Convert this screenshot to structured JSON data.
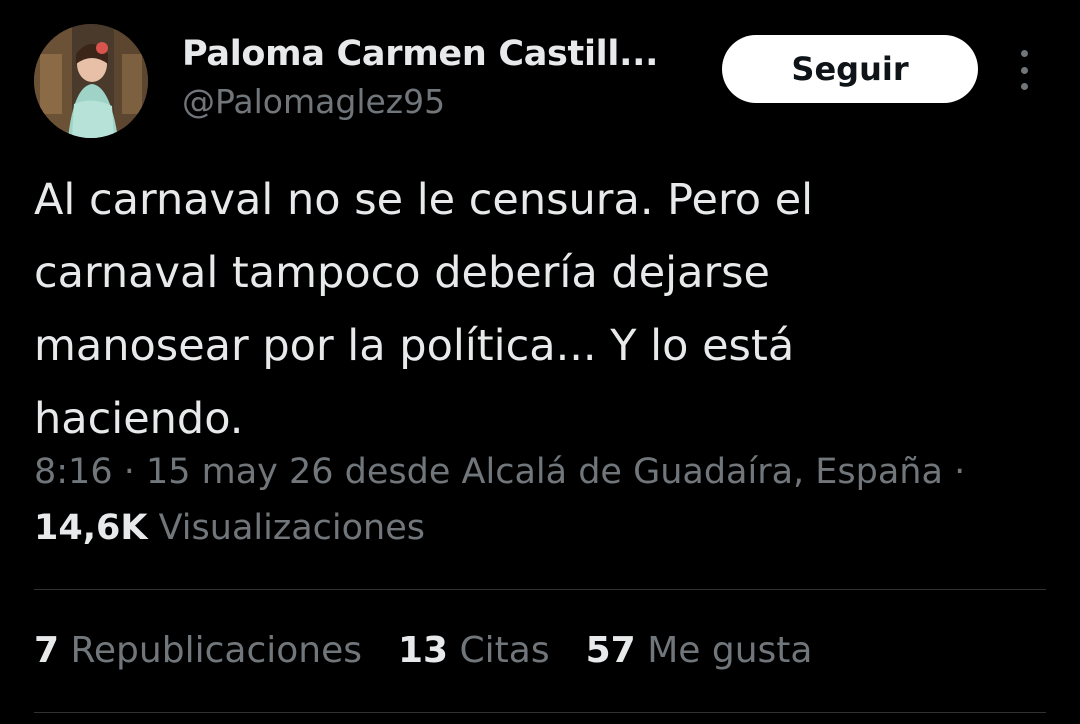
{
  "user": {
    "display_name": "Paloma Carmen Castill...",
    "handle": "@Palomaglez95",
    "follow_label": "Seguir"
  },
  "tweet": {
    "text": "Al carnaval no se le censura. Pero el\ncarnaval tampoco debería dejarse\nmanosear por la política... Y lo está\nhaciendo.",
    "meta": "8:16 · 15 may 26 desde Alcalá de Guadaíra, España ·",
    "views_count": "14,6K",
    "views_label": "Visualizaciones"
  },
  "stats": {
    "reposts_count": "7",
    "reposts_label": "Republicaciones",
    "quotes_count": "13",
    "quotes_label": "Citas",
    "likes_count": "57",
    "likes_label": "Me gusta"
  },
  "icons": {
    "more": "more-options-icon"
  },
  "colors": {
    "background": "#000000",
    "text_primary": "#e7e9ea",
    "text_secondary": "#71767b",
    "button_bg": "#ffffff",
    "divider": "#2f3336"
  }
}
